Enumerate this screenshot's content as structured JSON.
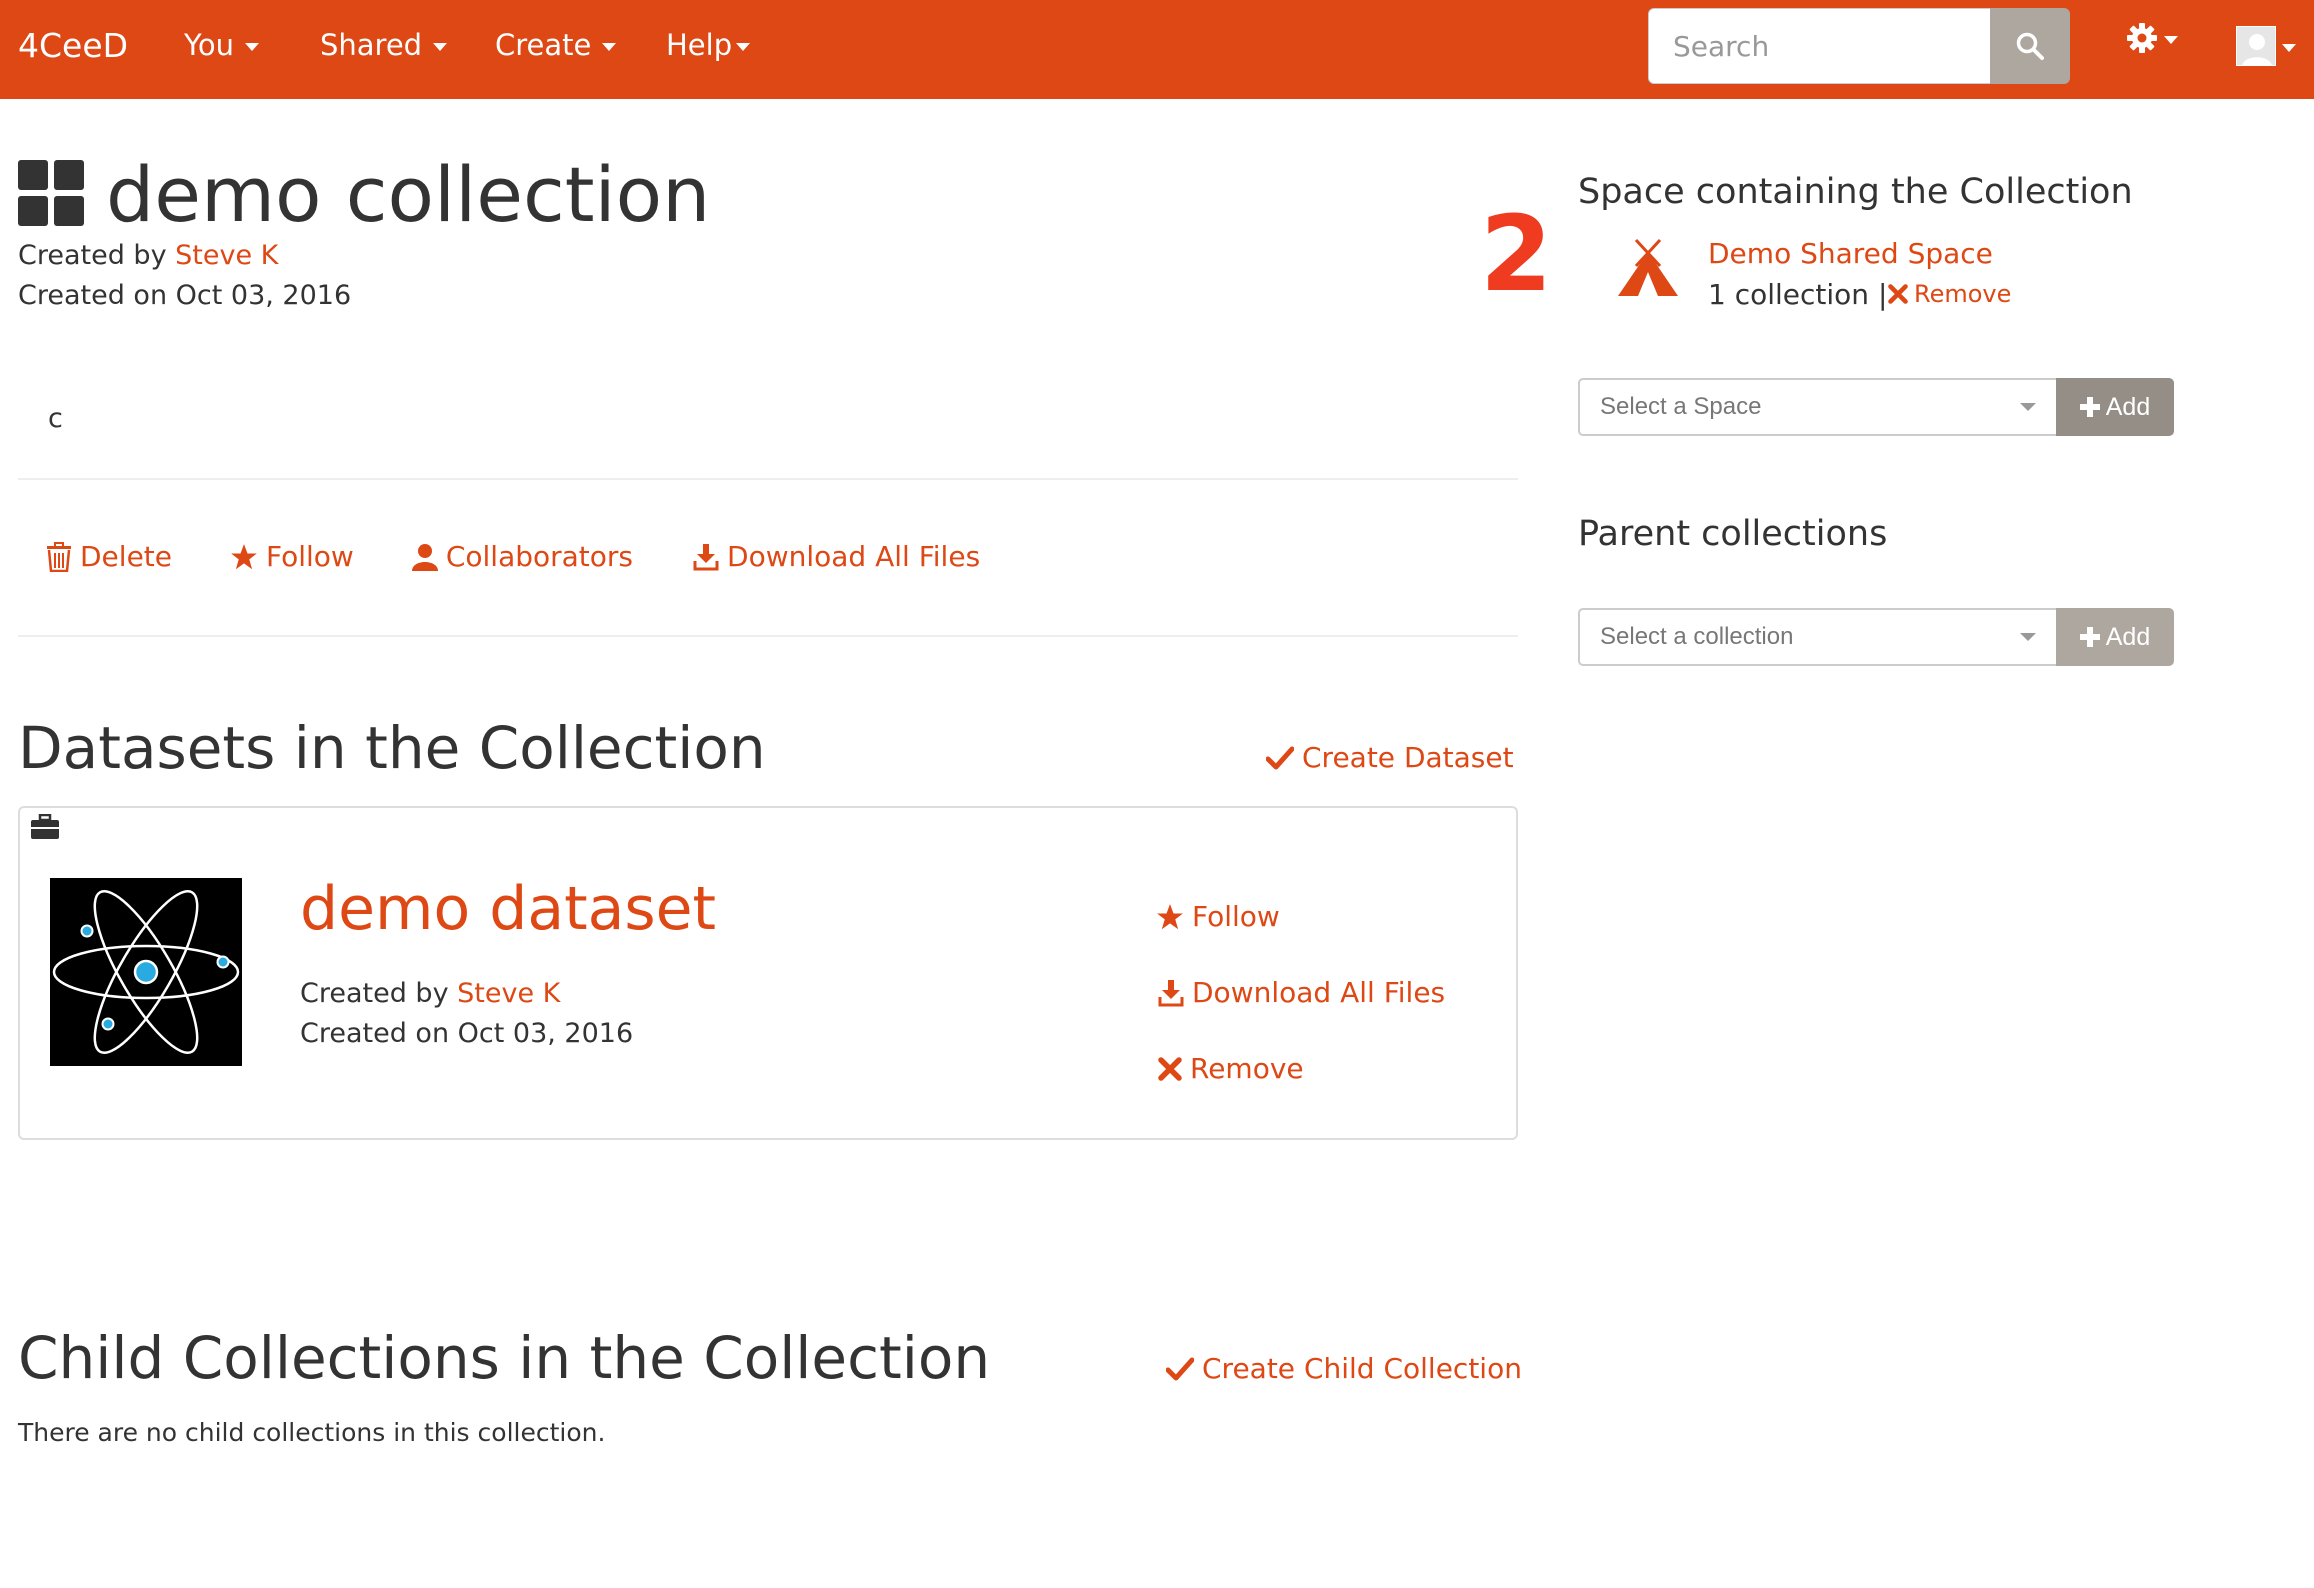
{
  "navbar": {
    "brand": "4CeeD",
    "menus": [
      "You",
      "Shared",
      "Create",
      "Help"
    ],
    "search_placeholder": "Search"
  },
  "collection": {
    "title": "demo collection",
    "created_by_label": "Created by ",
    "author": "Steve K",
    "created_on": "Created on Oct 03, 2016",
    "description": "c",
    "actions": {
      "delete": "Delete",
      "follow": "Follow",
      "collaborators": "Collaborators",
      "download": "Download All Files"
    }
  },
  "datasets_section": {
    "heading": "Datasets in the Collection",
    "create_label": "Create Dataset",
    "dataset": {
      "title": "demo dataset",
      "created_by_label": "Created by ",
      "author": "Steve K",
      "created_on": "Created on Oct 03, 2016",
      "follow": "Follow",
      "download": "Download All Files",
      "remove": "Remove"
    }
  },
  "child_section": {
    "heading": "Child Collections in the Collection",
    "create_label": "Create Child Collection",
    "empty_text": "There are no child collections in this collection."
  },
  "sidebar": {
    "annotation_number": "2",
    "space_heading": "Space containing the Collection",
    "space_name": "Demo Shared Space",
    "space_count": "1 collection |",
    "space_remove": "Remove",
    "space_select_placeholder": "Select a Space",
    "add_label": "Add",
    "parent_heading": "Parent collections",
    "parent_select_placeholder": "Select a collection"
  },
  "colors": {
    "brand": "#dd4814",
    "add_space_button": "#958e86",
    "add_collection_button": "#aea79f",
    "annotation": "#ef3b1f"
  }
}
